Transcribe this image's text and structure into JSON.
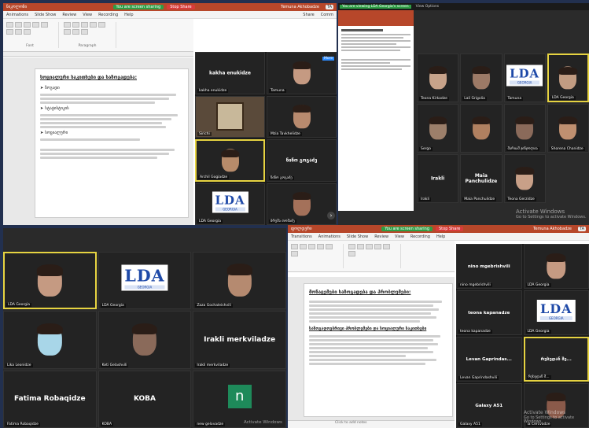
{
  "q1": {
    "title": "ნიკოლოზი",
    "sharing": "You are screen sharing",
    "stop": "Stop Share",
    "user": "Temuna Akhobadze",
    "user_initials": "TA",
    "tabs": [
      "Animations",
      "Slide Show",
      "Review",
      "View",
      "Recording",
      "Help"
    ],
    "share_label": "Share",
    "comments_label": "Comm",
    "font_label": "Font",
    "paragraph_label": "Paragraph",
    "slide_title": "სოციალური საკითხები და საზოგადება:",
    "bullets": [
      "ზოგადი",
      "სტატისტიკის",
      "სოციალური"
    ],
    "more": "More",
    "participants": [
      {
        "name": "kakha enukidze",
        "label": "kakha enukidze",
        "type": "text"
      },
      {
        "name": "Tamuna",
        "type": "face",
        "color": "#c59a82"
      },
      {
        "name": "Sirichi",
        "type": "room"
      },
      {
        "name": "Mzia Tavkhelidze",
        "type": "face",
        "color": "#b88a6e"
      },
      {
        "name": "Archil Gogiadze",
        "type": "face",
        "color": "#b78b6a",
        "active": true
      },
      {
        "name": "ნინო გოგაძე",
        "label": "ნინო გოგაძე",
        "type": "text"
      },
      {
        "name": "LDA Georgia",
        "type": "logo"
      },
      {
        "name": "ბრუშა თომაძე",
        "type": "face",
        "color": "#a4715a"
      }
    ]
  },
  "q2": {
    "sharing": "You are viewing LDA Georgia's screen",
    "view_options": "View Options",
    "participants": [
      {
        "name": "Teona Kirkadze",
        "type": "face",
        "color": "#c8a38a"
      },
      {
        "name": "Lali Grigolia",
        "type": "face",
        "color": "#9d7a66"
      },
      {
        "name": "Tamuna",
        "type": "logo"
      },
      {
        "name": "LDA Georgia",
        "type": "face",
        "color": "#c29c82",
        "active": true
      },
      {
        "name": "Sergo",
        "type": "face",
        "color": "#9c7f6a"
      },
      {
        "name": "",
        "type": "face",
        "color": "#b08060"
      },
      {
        "name": "მარიამ ჯინჯოლია",
        "type": "face",
        "color": "#8a6a5a"
      },
      {
        "name": "Shorena Chanidze",
        "type": "face",
        "color": "#c09070"
      },
      {
        "name": "Irakli",
        "label": "Irakli",
        "type": "text"
      },
      {
        "name": "Maia Panchulidze",
        "label": "Maia Panchulidze",
        "type": "text"
      },
      {
        "name": "Teona Gerzidze",
        "type": "face",
        "color": "#c8a088"
      }
    ],
    "activate": "Activate Windows",
    "activate_sub": "Go to Settings to activate Windows."
  },
  "q3": {
    "participants": [
      {
        "name": "LDA Georgia",
        "type": "face",
        "color": "#c59a82",
        "active": true
      },
      {
        "name": "LDA Georgia",
        "type": "logo"
      },
      {
        "name": "Zaza Gochaleishvili",
        "type": "face",
        "color": "#b58a70"
      },
      {
        "name": "Lika Leonidze",
        "type": "face",
        "color": "#a8d6e8"
      },
      {
        "name": "Keti Gelashvili",
        "type": "face",
        "color": "#8a6a5a"
      },
      {
        "name": "Irakli merkviladze",
        "label": "Irakli merkviladze",
        "type": "text"
      },
      {
        "name": "Fatima Robaqidze",
        "label": "Fatima Robaqidze",
        "type": "text"
      },
      {
        "name": "KOBA",
        "label": "KOBA",
        "type": "text"
      },
      {
        "name": "new gelovadze",
        "label": "n",
        "type": "avatar"
      }
    ],
    "activate": "Activate Windows"
  },
  "q4": {
    "title": "ფოლდერი",
    "sharing": "You are screen sharing",
    "stop": "Stop Share",
    "user": "Temuna Akhobadze",
    "user_initials": "TA",
    "tabs": [
      "Transitions",
      "Animations",
      "Slide Show",
      "Review",
      "View",
      "Recording",
      "Help"
    ],
    "slide_title": "მონაცემები საზოგადება და პრობლემები:",
    "slide_subtitle": "საზოგადოებრივი პრობლემები და სოციალური საკითხები",
    "notes": "Click to add notes",
    "participants": [
      {
        "name": "nino mgebrishvili",
        "label": "nino mgebrishvili",
        "type": "text"
      },
      {
        "name": "LDA Georgia",
        "type": "face",
        "color": "#c59a82"
      },
      {
        "name": "teona kapanadze",
        "label": "teona kapanadze",
        "type": "text"
      },
      {
        "name": "LDA Georgia",
        "type": "logo"
      },
      {
        "name": "Levan Gaprindashvili",
        "label": "Levan Gaprindas...",
        "type": "text"
      },
      {
        "name": "რუსუდან შ...",
        "label": "რუსუდან შე...",
        "type": "text",
        "active": true
      },
      {
        "name": "Galaxy A51",
        "label": "Galaxy A51",
        "type": "text"
      },
      {
        "name": "ia Cercvadze",
        "type": "face",
        "color": "#8a5a4a"
      }
    ],
    "activate": "Activate Windows",
    "activate_sub": "Go to Settings to activate Windows."
  },
  "logo": {
    "main": "LDA",
    "sub": "GEORGIA"
  }
}
